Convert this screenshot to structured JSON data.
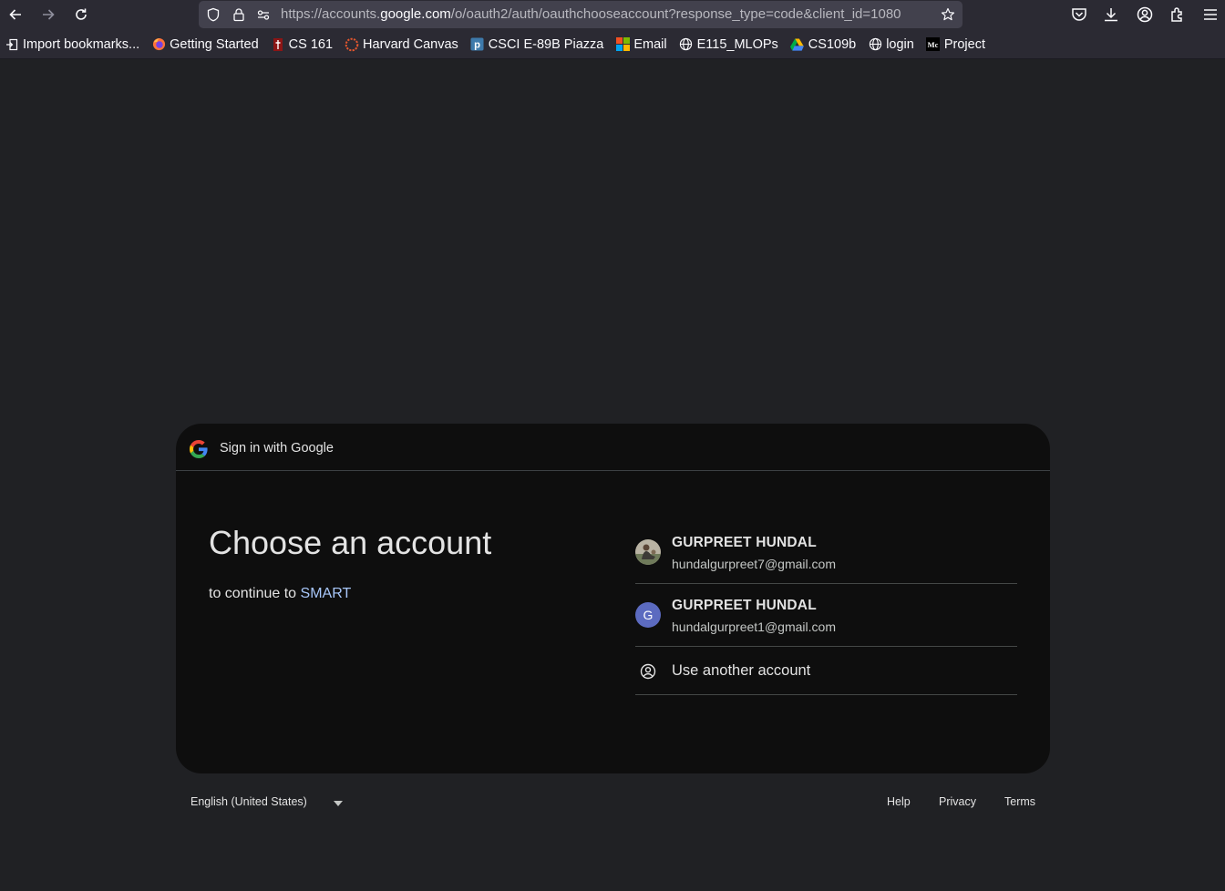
{
  "browser": {
    "url_prefix": "https://accounts.",
    "url_domain": "google.com",
    "url_rest": "/o/oauth2/auth/oauthchooseaccount?response_type=code&client_id=1080",
    "bookmarks": [
      {
        "label": "Import bookmarks...",
        "icon": "import-icon"
      },
      {
        "label": "Getting Started",
        "icon": "firefox-icon"
      },
      {
        "label": "CS 161",
        "icon": "stanford-icon"
      },
      {
        "label": "Harvard Canvas",
        "icon": "canvas-icon"
      },
      {
        "label": "CSCI E-89B Piazza",
        "icon": "piazza-icon"
      },
      {
        "label": "Email",
        "icon": "microsoft-icon"
      },
      {
        "label": "E115_MLOPs",
        "icon": "globe-icon"
      },
      {
        "label": "CS109b",
        "icon": "drive-icon"
      },
      {
        "label": "login",
        "icon": "globe-icon"
      },
      {
        "label": "Project",
        "icon": "medium-icon"
      }
    ]
  },
  "card": {
    "header_title": "Sign in with Google",
    "title": "Choose an account",
    "subtitle_prefix": "to continue to",
    "app_name": "SMART",
    "accounts": [
      {
        "name": "GURPREET HUNDAL",
        "email": "hundalgurpreet7@gmail.com",
        "avatar": "photo"
      },
      {
        "name": "GURPREET HUNDAL",
        "email": "hundalgurpreet1@gmail.com",
        "avatar_letter": "G",
        "avatar_color": "#5c6bc0"
      }
    ],
    "another_account": "Use another account"
  },
  "footer": {
    "language": "English (United States)",
    "help": "Help",
    "privacy": "Privacy",
    "terms": "Terms"
  }
}
